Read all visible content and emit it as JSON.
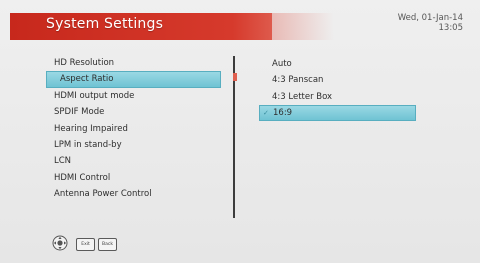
{
  "header": {
    "title": "System Settings",
    "date": "Wed, 01-Jan-14",
    "time": "13:05"
  },
  "menu": {
    "items": [
      {
        "label": "HD Resolution",
        "selected": false
      },
      {
        "label": "Aspect Ratio",
        "selected": true
      },
      {
        "label": "HDMI output mode",
        "selected": false
      },
      {
        "label": "SPDIF Mode",
        "selected": false
      },
      {
        "label": "Hearing Impaired",
        "selected": false
      },
      {
        "label": "LPM in stand-by",
        "selected": false
      },
      {
        "label": "LCN",
        "selected": false
      },
      {
        "label": "HDMI Control",
        "selected": false
      },
      {
        "label": "Antenna Power Control",
        "selected": false
      }
    ]
  },
  "options": {
    "items": [
      {
        "label": "Auto",
        "selected": false
      },
      {
        "label": "4:3 Panscan",
        "selected": false
      },
      {
        "label": "4:3 Letter Box",
        "selected": false
      },
      {
        "label": "16:9",
        "selected": true
      }
    ]
  },
  "footer": {
    "nav_icon": "navigation-dpad-icon",
    "exit_label": "Exit",
    "back_label": "Back"
  },
  "colors": {
    "title_bar": "#c7281c",
    "highlight": "#7ecbd9",
    "background": "#e9e9e9"
  }
}
